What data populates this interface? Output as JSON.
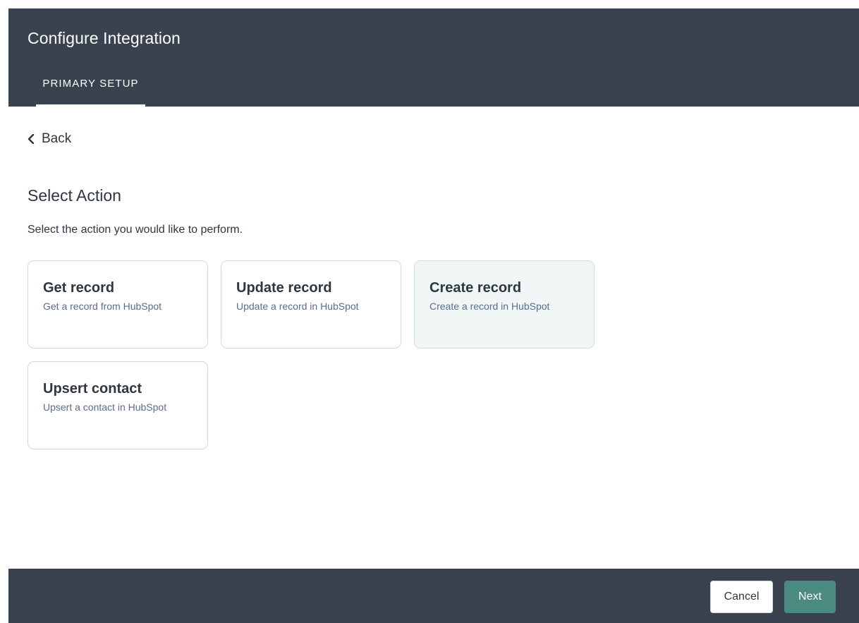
{
  "header": {
    "title": "Configure Integration",
    "tabs": [
      {
        "label": "PRIMARY SETUP",
        "active": true
      }
    ]
  },
  "back": {
    "label": "Back"
  },
  "section": {
    "title": "Select Action",
    "description": "Select the action you would like to perform."
  },
  "actions": [
    {
      "title": "Get record",
      "description": "Get a record from HubSpot",
      "selected": false
    },
    {
      "title": "Update record",
      "description": "Update a record in HubSpot",
      "selected": false
    },
    {
      "title": "Create record",
      "description": "Create a record in HubSpot",
      "selected": true
    },
    {
      "title": "Upsert contact",
      "description": "Upsert a contact in HubSpot",
      "selected": false
    }
  ],
  "footer": {
    "cancel_label": "Cancel",
    "next_label": "Next"
  },
  "colors": {
    "header_bg": "#3a4250",
    "selected_card_bg": "#f0f7f6",
    "primary_button": "#4a8a80"
  },
  "icons": {
    "back": "chevron-left-icon"
  }
}
